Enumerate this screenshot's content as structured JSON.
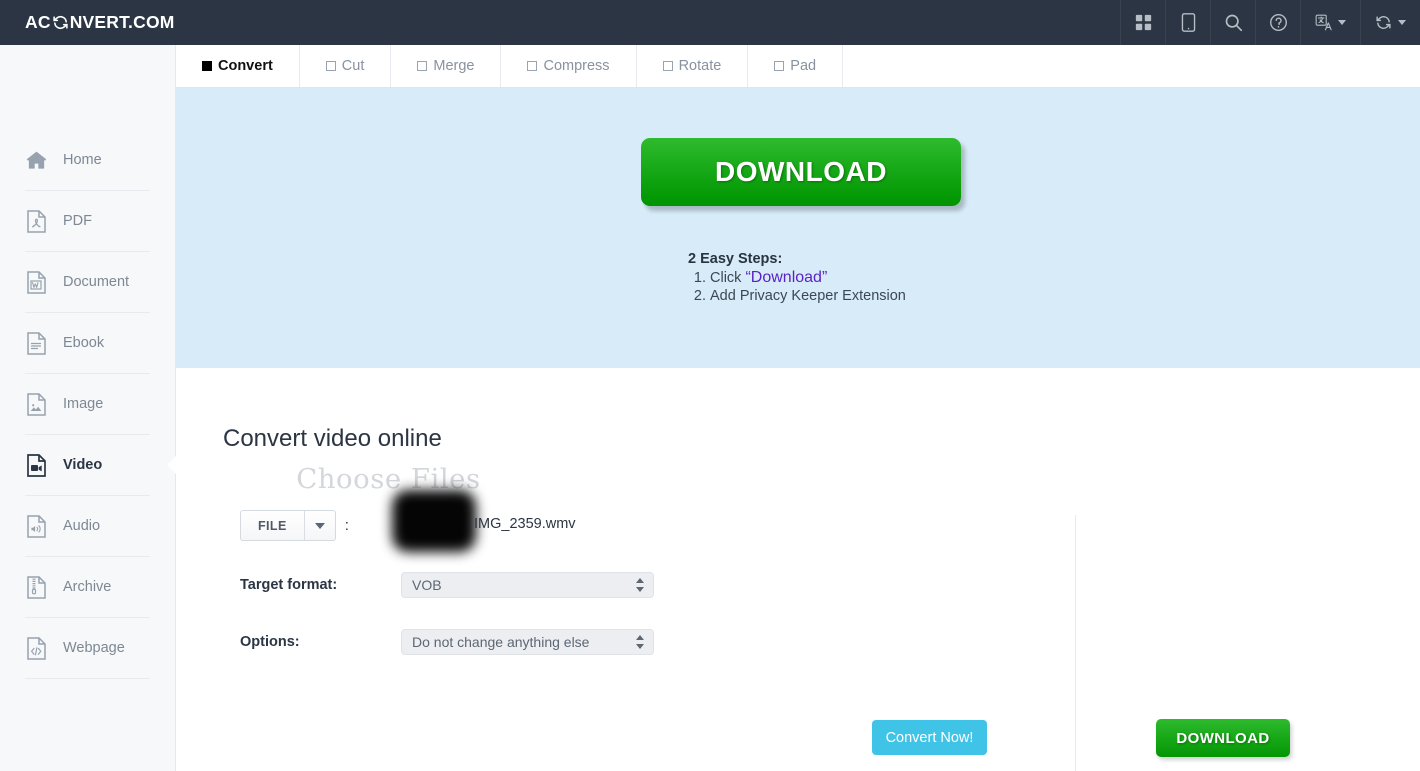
{
  "header": {
    "brand_prefix": "AC",
    "brand_suffix": "NVERT.COM",
    "brand_icon": "cycle-icon",
    "tools": [
      {
        "name": "apps-grid-icon",
        "label": ""
      },
      {
        "name": "tablet-icon",
        "label": ""
      },
      {
        "name": "search-icon",
        "label": ""
      },
      {
        "name": "help-circle-icon",
        "label": ""
      },
      {
        "name": "language-icon",
        "label": ""
      },
      {
        "name": "convert-refresh-icon",
        "label": ""
      }
    ]
  },
  "sidebar": {
    "items": [
      {
        "label": "Home",
        "icon": "home-icon",
        "active": false
      },
      {
        "label": "PDF",
        "icon": "pdf-file-icon",
        "active": false
      },
      {
        "label": "Document",
        "icon": "word-document-icon",
        "active": false
      },
      {
        "label": "Ebook",
        "icon": "ebook-file-icon",
        "active": false
      },
      {
        "label": "Image",
        "icon": "image-file-icon",
        "active": false
      },
      {
        "label": "Video",
        "icon": "video-file-icon",
        "active": true
      },
      {
        "label": "Audio",
        "icon": "audio-file-icon",
        "active": false
      },
      {
        "label": "Archive",
        "icon": "archive-file-icon",
        "active": false
      },
      {
        "label": "Webpage",
        "icon": "code-file-icon",
        "active": false
      }
    ]
  },
  "tabs": [
    {
      "label": "Convert",
      "active": true
    },
    {
      "label": "Cut",
      "active": false
    },
    {
      "label": "Merge",
      "active": false
    },
    {
      "label": "Compress",
      "active": false
    },
    {
      "label": "Rotate",
      "active": false
    },
    {
      "label": "Pad",
      "active": false
    }
  ],
  "ad": {
    "download_label": "DOWNLOAD",
    "steps_heading": "2 Easy Steps:",
    "step_1_prefix": "Click",
    "step_1_quoted": "“Download”",
    "step_2": "Add Privacy Keeper Extension",
    "background_color": "#d7ecf8",
    "button_color": "#16a816"
  },
  "main": {
    "title": "Convert video online",
    "watermark": "Choose Files",
    "file_row": {
      "button_label": "FILE",
      "separator": ":",
      "redacted_button_label": "",
      "filename": "IMG_2359.wmv"
    },
    "target_format": {
      "label": "Target format:",
      "value": "VOB"
    },
    "options": {
      "label": "Options:",
      "value": "Do not change anything else"
    },
    "convert_button": "Convert Now!",
    "download_button": "DOWNLOAD",
    "accent_color": "#3fc4e8"
  }
}
